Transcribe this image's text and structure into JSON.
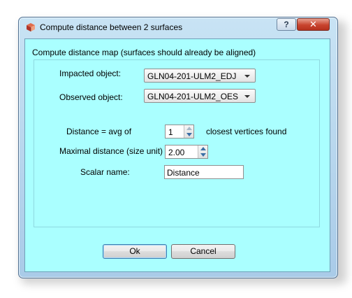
{
  "window": {
    "title": "Compute distance between 2 surfaces",
    "help_label": "?",
    "close_label": "✕"
  },
  "group": {
    "title": "Compute distance map (surfaces should already be aligned)"
  },
  "form": {
    "impacted_label": "Impacted object:",
    "impacted_value": "GLN04-201-ULM2_EDJ",
    "observed_label": "Observed object:",
    "observed_value": "GLN04-201-ULM2_OES",
    "distance_avg_label": "Distance = avg of",
    "distance_avg_value": "1",
    "closest_label": "closest vertices found",
    "maximal_label": "Maximal distance (size unit)",
    "maximal_value": "2.00",
    "scalar_label": "Scalar name:",
    "scalar_value": "Distance"
  },
  "buttons": {
    "ok_label": "Ok",
    "cancel_label": "Cancel"
  },
  "colors": {
    "client_background": "#aaffff",
    "titlebar": "#b9d7ee",
    "close_button": "#c8432e"
  },
  "icons": {
    "app": "app-cube-icon",
    "combo_arrow": "chevron-down-icon",
    "spin_up": "spin-up-icon",
    "spin_down": "spin-down-icon"
  }
}
